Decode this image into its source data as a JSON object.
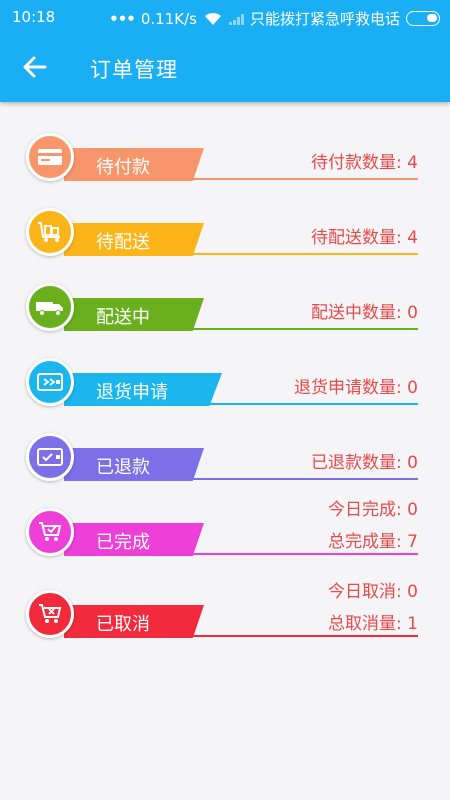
{
  "status": {
    "time": "10:18",
    "dots": "•••",
    "speed": "0.11K/s",
    "carrier": "只能拨打紧急呼救电话"
  },
  "header": {
    "title": "订单管理"
  },
  "orders": [
    {
      "label": "待付款",
      "count": "待付款数量: 4",
      "color": "#f7956b",
      "icon": "credit-card-icon"
    },
    {
      "label": "待配送",
      "count": "待配送数量: 4",
      "color": "#fcb519",
      "icon": "luggage-cart-icon"
    },
    {
      "label": "配送中",
      "count": "配送中数量: 0",
      "color": "#6ab01e",
      "icon": "delivery-truck-icon"
    },
    {
      "label": "退货申请",
      "count": "退货申请数量: 0",
      "color": "#1cb6ee",
      "icon": "return-wallet-icon"
    },
    {
      "label": "已退款",
      "count": "已退款数量: 0",
      "color": "#7e6ee8",
      "icon": "refund-wallet-icon"
    },
    {
      "label": "已完成",
      "today": "今日完成: 0",
      "total": "总完成量: 7",
      "color": "#ee3fd9",
      "icon": "cart-check-icon"
    },
    {
      "label": "已取消",
      "today": "今日取消: 0",
      "total": "总取消量: 1",
      "color": "#f12b3b",
      "icon": "cart-cancel-icon"
    }
  ]
}
